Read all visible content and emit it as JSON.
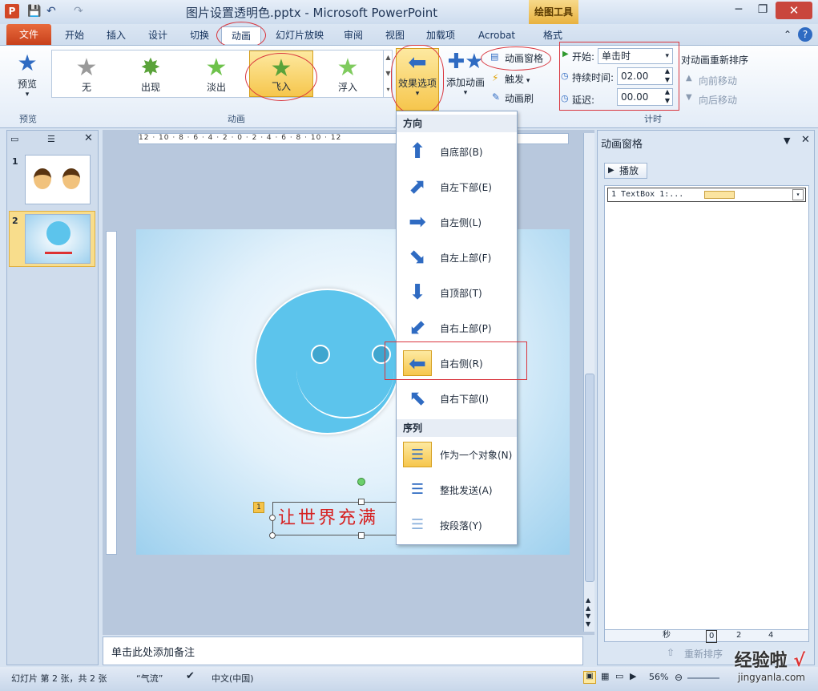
{
  "window": {
    "title": "图片设置透明色.pptx - Microsoft PowerPoint",
    "context_tab": "绘图工具",
    "context_sub": "格式"
  },
  "tabs": [
    "文件",
    "开始",
    "插入",
    "设计",
    "切换",
    "动画",
    "幻灯片放映",
    "审阅",
    "视图",
    "加载项",
    "Acrobat"
  ],
  "ribbon": {
    "preview_label": "预览",
    "preview_group": "预览",
    "gallery": [
      {
        "label": "无",
        "color": "#9a9a9a"
      },
      {
        "label": "出现",
        "color": "#5aa33a"
      },
      {
        "label": "淡出",
        "color": "#6ec24b"
      },
      {
        "label": "飞入",
        "color": "#5aa33a",
        "selected": true
      },
      {
        "label": "浮入",
        "color": "#7fcb5e"
      }
    ],
    "anim_group": "动画",
    "effect_options": "效果选项",
    "add_animation": "添加动画",
    "anim_pane_btn": "动画窗格",
    "trigger": "触发",
    "anim_painter": "动画刷",
    "start_label": "开始:",
    "start_value": "单击时",
    "duration_label": "持续时间:",
    "duration_value": "02.00",
    "delay_label": "延迟:",
    "delay_value": "00.00",
    "reorder_title": "对动画重新排序",
    "move_earlier": "向前移动",
    "move_later": "向后移动",
    "timing_group": "计时"
  },
  "slides": [
    {
      "number": "1"
    },
    {
      "number": "2"
    }
  ],
  "slide_textbox": "让世界充满",
  "anim_tag": "1",
  "dropdown": {
    "direction_header": "方向",
    "directions": [
      {
        "label": "自底部(B)",
        "arrow": "⬆"
      },
      {
        "label": "自左下部(E)",
        "arrow": "⬈"
      },
      {
        "label": "自左侧(L)",
        "arrow": "➡"
      },
      {
        "label": "自左上部(F)",
        "arrow": "⬊"
      },
      {
        "label": "自顶部(T)",
        "arrow": "⬇"
      },
      {
        "label": "自右上部(P)",
        "arrow": "⬋"
      },
      {
        "label": "自右侧(R)",
        "arrow": "⬅",
        "selected": true
      },
      {
        "label": "自右下部(I)",
        "arrow": "⬉"
      }
    ],
    "sequence_header": "序列",
    "sequences": [
      {
        "label": "作为一个对象(N)",
        "selected": true
      },
      {
        "label": "整批发送(A)"
      },
      {
        "label": "按段落(Y)"
      }
    ]
  },
  "anim_pane": {
    "title": "动画窗格",
    "play": "播放",
    "item": "1  TextBox 1:...",
    "seconds_label": "秒",
    "timeline": [
      "0",
      "2",
      "4"
    ],
    "reorder": "重新排序"
  },
  "notes_placeholder": "单击此处添加备注",
  "status": {
    "slide_info": "幻灯片 第 2 张，共 2 张",
    "theme": "“气流”",
    "language": "中文(中国)",
    "zoom": "56%"
  },
  "watermark": "经验啦",
  "watermark_sub": "jingyanla.com",
  "ruler_text": "12 · 10 · 8 · 6 · 4 · 2 · 0 · 2 · 4 · 6 · 8 · 10 · 12"
}
